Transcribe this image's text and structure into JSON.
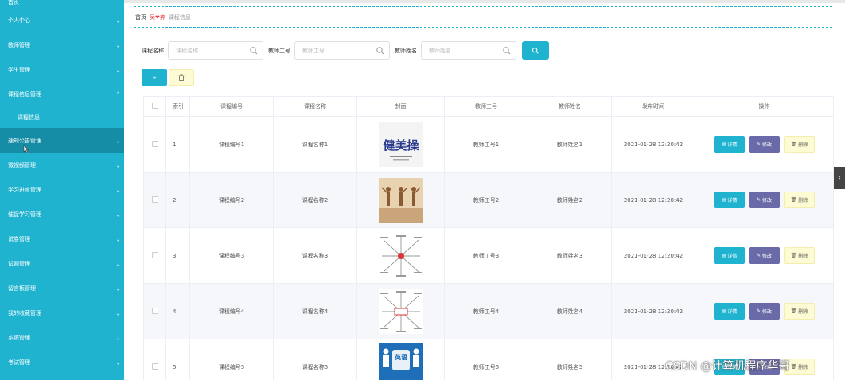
{
  "sidebar": {
    "top_item": "首页",
    "items": [
      {
        "label": "个人中心"
      },
      {
        "label": "教师管理"
      },
      {
        "label": "学生管理"
      },
      {
        "label": "课程信息管理",
        "expanded": true
      },
      {
        "label": "通知公告管理",
        "active": true
      },
      {
        "label": "微视频管理"
      },
      {
        "label": "学习进度管理"
      },
      {
        "label": "催促学习管理"
      },
      {
        "label": "试卷管理"
      },
      {
        "label": "试题管理"
      },
      {
        "label": "留言板管理"
      },
      {
        "label": "我的收藏管理"
      },
      {
        "label": "系统管理"
      },
      {
        "label": "考试管理"
      }
    ],
    "sub_item": "课程信息"
  },
  "breadcrumb": {
    "home": "首页",
    "heart_text": "吴",
    "heart_text2": "奔",
    "current": "课程信息"
  },
  "search": {
    "fields": [
      {
        "label": "课程名称",
        "placeholder": "课程名称"
      },
      {
        "label": "教师工号",
        "placeholder": "教师工号"
      },
      {
        "label": "教师姓名",
        "placeholder": "教师姓名"
      }
    ]
  },
  "actions": {
    "add_label": "+"
  },
  "table": {
    "headers": [
      "索引",
      "课程编号",
      "课程名称",
      "封面",
      "教师工号",
      "教师姓名",
      "发布时间",
      "操作"
    ],
    "rows": [
      {
        "index": "1",
        "code": "课程编号1",
        "name": "课程名称1",
        "teacher_no": "教师工号1",
        "teacher_name": "教师姓名1",
        "time": "2021-01-28 12:20:42"
      },
      {
        "index": "2",
        "code": "课程编号2",
        "name": "课程名称2",
        "teacher_no": "教师工号2",
        "teacher_name": "教师姓名2",
        "time": "2021-01-28 12:20:42"
      },
      {
        "index": "3",
        "code": "课程编号3",
        "name": "课程名称3",
        "teacher_no": "教师工号3",
        "teacher_name": "教师姓名3",
        "time": "2021-01-28 12:20:42"
      },
      {
        "index": "4",
        "code": "课程编号4",
        "name": "课程名称4",
        "teacher_no": "教师工号4",
        "teacher_name": "教师姓名4",
        "time": "2021-01-28 12:20:42"
      },
      {
        "index": "5",
        "code": "课程编号5",
        "name": "课程名称5",
        "teacher_no": "教师工号5",
        "teacher_name": "教师姓名5",
        "time": "2021-01-28 12:20:42"
      }
    ],
    "op_labels": {
      "detail": "详情",
      "edit": "修改",
      "delete": "删除"
    }
  },
  "covers": {
    "c1_text": "健美操",
    "c5_text": "英语"
  },
  "watermark": "CSDN @计算机程序华哥",
  "colors": {
    "accent": "#1fb3cf",
    "sidebar_active": "#168da6",
    "edit": "#6a6aa8",
    "delete_bg": "#fdfbd3"
  }
}
